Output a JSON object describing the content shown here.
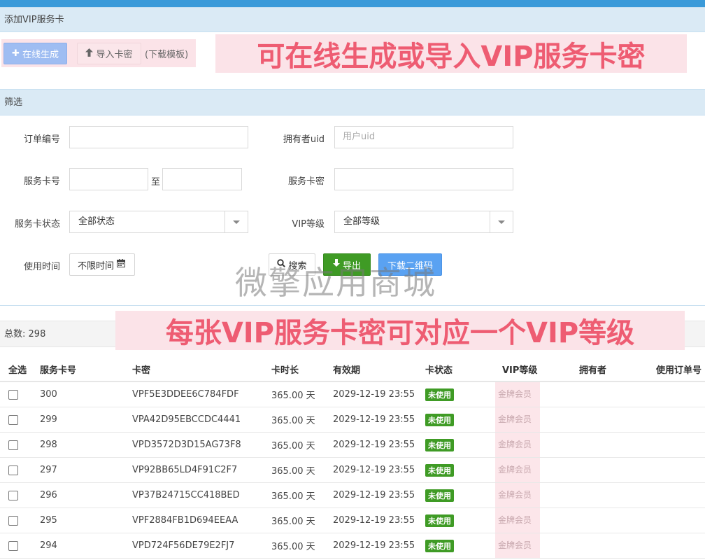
{
  "section_add": {
    "title": "添加VIP服务卡"
  },
  "actions": {
    "generate_label": "在线生成",
    "import_label": "导入卡密",
    "template_link": "(下载模板)"
  },
  "banner_top": "可在线生成或导入VIP服务卡密",
  "section_filter": {
    "title": "筛选"
  },
  "filters": {
    "order_no_label": "订单编号",
    "order_no_value": "",
    "owner_uid_label": "拥有者uid",
    "owner_uid_placeholder": "用户uid",
    "card_no_label": "服务卡号",
    "card_no_from": "",
    "range_sep": "至",
    "card_no_to": "",
    "card_secret_label": "服务卡密",
    "card_secret_value": "",
    "status_label": "服务卡状态",
    "status_value": "全部状态",
    "vip_level_label": "VIP等级",
    "vip_level_value": "全部等级",
    "use_time_label": "使用时间",
    "use_time_value": "不限时间",
    "search_label": "搜索",
    "export_label": "导出",
    "qrcode_label": "下载二维码"
  },
  "watermark": "微擎应用商城",
  "summary": {
    "total_label": "总数:",
    "total_value": "298"
  },
  "banner_bottom": "每张VIP服务卡密可对应一个VIP等级",
  "table": {
    "columns": [
      "全选",
      "服务卡号",
      "卡密",
      "卡时长",
      "有效期",
      "卡状态",
      "VIP等级",
      "拥有者",
      "使用订单号"
    ],
    "rows": [
      {
        "card_no": "300",
        "secret": "VPF5E3DDEE6C784FDF",
        "duration": "365.00 天",
        "expiry": "2029-12-19 23:55",
        "status": "未使用",
        "vip": "金牌会员",
        "owner": "",
        "order": ""
      },
      {
        "card_no": "299",
        "secret": "VPA42D95EBCCDC4441",
        "duration": "365.00 天",
        "expiry": "2029-12-19 23:55",
        "status": "未使用",
        "vip": "金牌会员",
        "owner": "",
        "order": ""
      },
      {
        "card_no": "298",
        "secret": "VPD3572D3D15AG73F8",
        "duration": "365.00 天",
        "expiry": "2029-12-19 23:55",
        "status": "未使用",
        "vip": "金牌会员",
        "owner": "",
        "order": ""
      },
      {
        "card_no": "297",
        "secret": "VP92BB65LD4F91C2F7",
        "duration": "365.00 天",
        "expiry": "2029-12-19 23:55",
        "status": "未使用",
        "vip": "金牌会员",
        "owner": "",
        "order": ""
      },
      {
        "card_no": "296",
        "secret": "VP37B24715CC418BED",
        "duration": "365.00 天",
        "expiry": "2029-12-19 23:55",
        "status": "未使用",
        "vip": "金牌会员",
        "owner": "",
        "order": ""
      },
      {
        "card_no": "295",
        "secret": "VPF2884FB1D694EEAA",
        "duration": "365.00 天",
        "expiry": "2029-12-19 23:55",
        "status": "未使用",
        "vip": "金牌会员",
        "owner": "",
        "order": ""
      },
      {
        "card_no": "294",
        "secret": "VPD724F56DE79E2FJ7",
        "duration": "365.00 天",
        "expiry": "2029-12-19 23:55",
        "status": "未使用",
        "vip": "金牌会员",
        "owner": "",
        "order": ""
      }
    ]
  },
  "colors": {
    "accent": "#3a9ad9",
    "success": "#3f9b25",
    "banner_text": "#ee5c72",
    "banner_bg": "#fbe3e8"
  }
}
